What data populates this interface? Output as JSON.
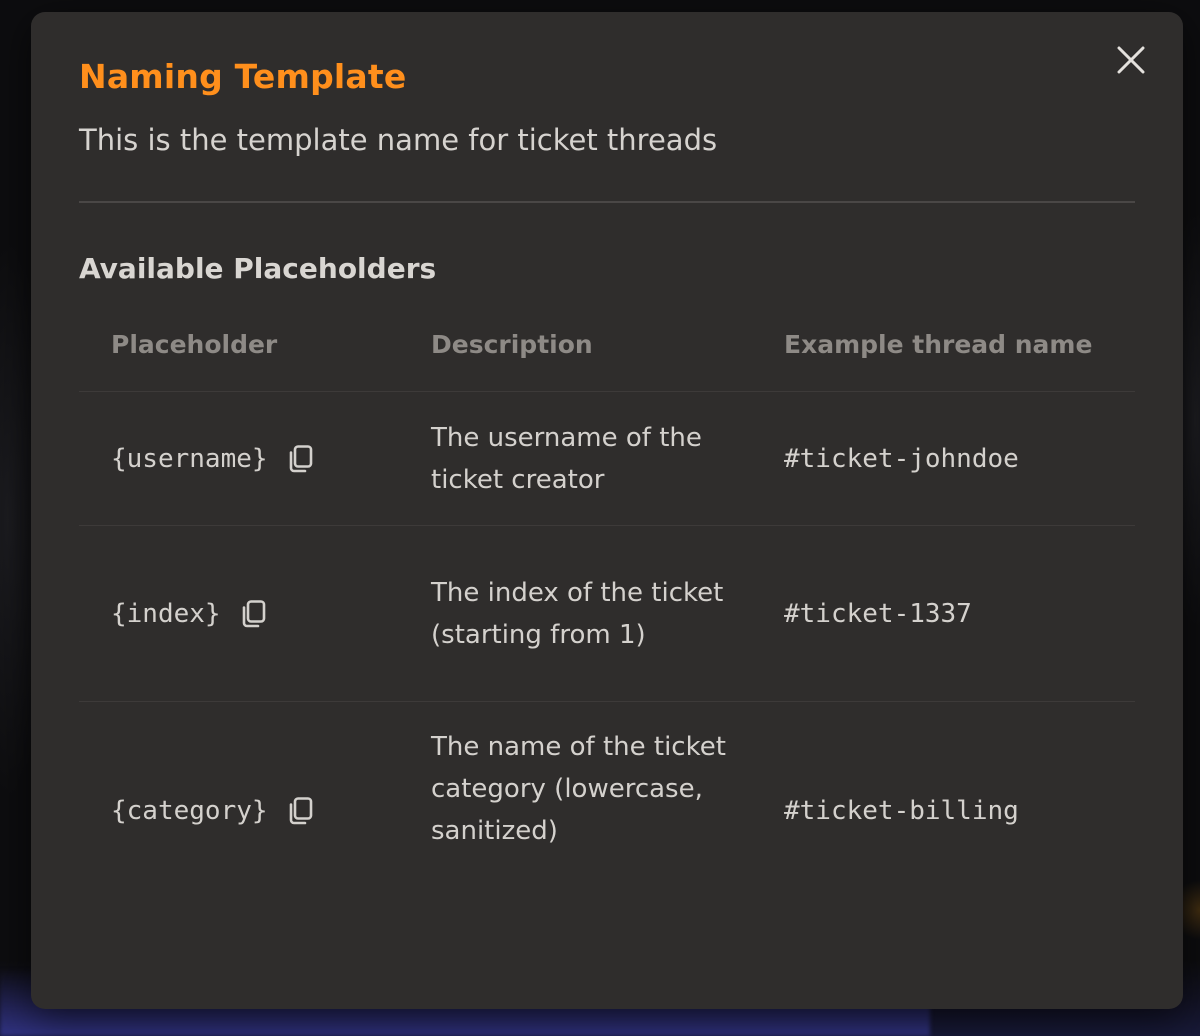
{
  "modal": {
    "title": "Naming Template",
    "subtitle": "This is the template name for ticket threads",
    "section_heading": "Available Placeholders",
    "close_icon": "close-icon"
  },
  "table": {
    "headers": [
      "Placeholder",
      "Description",
      "Example thread name"
    ],
    "rows": [
      {
        "placeholder": "{username}",
        "description": "The username of the ticket creator",
        "example": "#ticket-johndoe"
      },
      {
        "placeholder": "{index}",
        "description": "The index of the ticket (starting from 1)",
        "example": "#ticket-1337"
      },
      {
        "placeholder": "{category}",
        "description": "The name of the ticket category (lowercase, sanitized)",
        "example": "#ticket-billing"
      }
    ]
  },
  "colors": {
    "accent": "#ff8f1c",
    "modal_bg": "#2f2d2c",
    "text": "#d4d1cd",
    "header_text": "#8e8a86"
  }
}
